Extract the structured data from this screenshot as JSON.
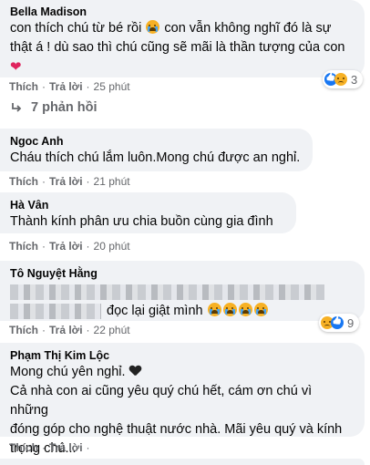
{
  "actions": {
    "like": "Thích",
    "reply": "Trả lời",
    "sep": "·"
  },
  "comments": [
    {
      "name": "Bella Madison",
      "lines": [
        "con thích chú từ bé rồi",
        " con vẫn không nghĩ đó là sự",
        "thật á ! dù sao thì chú cũng sẽ mãi là thần tượng của con"
      ],
      "emoji_after_first": "crying-face-icon",
      "trailing_emoji": "heart-icon",
      "time": "25 phút",
      "reaction_count": "3"
    },
    {
      "name": "Ngoc Anh",
      "lines": [
        "Cháu thích chú lắm luôn.Mong chú được an nghỉ."
      ],
      "time": "21 phút"
    },
    {
      "name": "Hà Vân",
      "lines": [
        "Thành kính phân ưu chia buồn cùng gia đình"
      ],
      "time": "20 phút"
    },
    {
      "name": "Tô Nguyệt Hằng",
      "lines": [
        "đọc lại giật mình"
      ],
      "time": "22 phút",
      "reaction_count": "9"
    },
    {
      "name": "Phạm Thị Kim Lộc",
      "lines": [
        "Mong chú yên nghỉ.",
        "Cả nhà con ai cũng yêu quý chú hết, cám ơn chú vì những",
        "đóng góp cho nghệ thuật nước nhà. Mãi yêu quý và kính",
        "trọng chú..."
      ],
      "time": ""
    }
  ],
  "replies_link": "7 phản hồi"
}
